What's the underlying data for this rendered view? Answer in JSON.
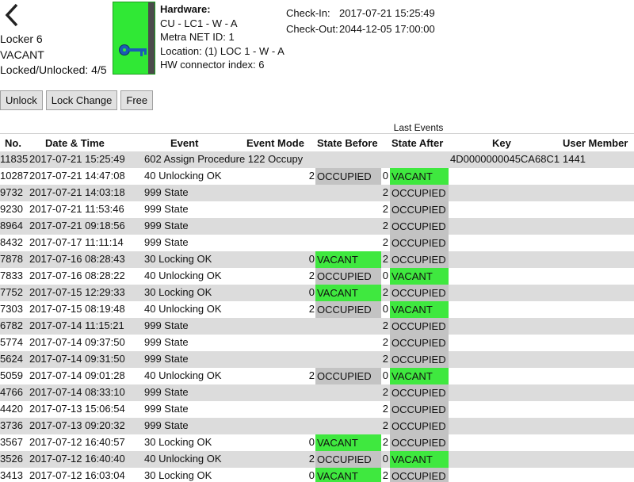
{
  "locker": {
    "name": "Locker 6",
    "status": "VACANT",
    "locked_unlocked": "Locked/Unlocked: 4/5",
    "tile_color": "#30e835",
    "icon": "key-icon"
  },
  "hardware": {
    "title": "Hardware:",
    "lines": [
      "CU - LC1 - W - A",
      "Metra NET ID: 1",
      "Location: (1) LOC 1 - W - A",
      "HW connector index: 6"
    ]
  },
  "checks": {
    "checkin_label": "Check-In:",
    "checkin_value": "2017-07-21 15:25:49",
    "checkout_label": "Check-Out:",
    "checkout_value": "2044-12-05 17:00:00"
  },
  "buttons": {
    "unlock": "Unlock",
    "lock_change": "Lock Change",
    "free": "Free"
  },
  "events": {
    "title": "Last Events",
    "headers": [
      "No.",
      "Date & Time",
      "Event",
      "Event Mode",
      "State Before",
      "State After",
      "Key",
      "User Member"
    ],
    "colors": {
      "occupied": "#c3c3c3",
      "vacant": "#3fe83f",
      "row_stripe": "#dcdcdc"
    },
    "rows": [
      {
        "no": "11835",
        "dt": "2017-07-21 15:25:49",
        "event": "602 Assign Procedure 122 Occupy",
        "sbn": "",
        "sb": "",
        "san": "",
        "sa": "",
        "key": "4D0000000045CA68C1",
        "um": "1441"
      },
      {
        "no": "10287",
        "dt": "2017-07-21 14:47:08",
        "event": "40 Unlocking OK",
        "sbn": "2",
        "sb": "OCCUPIED",
        "san": "0",
        "sa": "VACANT",
        "key": "",
        "um": ""
      },
      {
        "no": "9732",
        "dt": "2017-07-21 14:03:18",
        "event": "999 State",
        "sbn": "",
        "sb": "",
        "san": "2",
        "sa": "OCCUPIED",
        "key": "",
        "um": ""
      },
      {
        "no": "9230",
        "dt": "2017-07-21 11:53:46",
        "event": "999 State",
        "sbn": "",
        "sb": "",
        "san": "2",
        "sa": "OCCUPIED",
        "key": "",
        "um": ""
      },
      {
        "no": "8964",
        "dt": "2017-07-21 09:18:56",
        "event": "999 State",
        "sbn": "",
        "sb": "",
        "san": "2",
        "sa": "OCCUPIED",
        "key": "",
        "um": ""
      },
      {
        "no": "8432",
        "dt": "2017-07-17 11:11:14",
        "event": "999 State",
        "sbn": "",
        "sb": "",
        "san": "2",
        "sa": "OCCUPIED",
        "key": "",
        "um": ""
      },
      {
        "no": "7878",
        "dt": "2017-07-16 08:28:43",
        "event": "30 Locking OK",
        "sbn": "0",
        "sb": "VACANT",
        "san": "2",
        "sa": "OCCUPIED",
        "key": "",
        "um": ""
      },
      {
        "no": "7833",
        "dt": "2017-07-16 08:28:22",
        "event": "40 Unlocking OK",
        "sbn": "2",
        "sb": "OCCUPIED",
        "san": "0",
        "sa": "VACANT",
        "key": "",
        "um": ""
      },
      {
        "no": "7752",
        "dt": "2017-07-15 12:29:33",
        "event": "30 Locking OK",
        "sbn": "0",
        "sb": "VACANT",
        "san": "2",
        "sa": "OCCUPIED",
        "key": "",
        "um": ""
      },
      {
        "no": "7303",
        "dt": "2017-07-15 08:19:48",
        "event": "40 Unlocking OK",
        "sbn": "2",
        "sb": "OCCUPIED",
        "san": "0",
        "sa": "VACANT",
        "key": "",
        "um": ""
      },
      {
        "no": "6782",
        "dt": "2017-07-14 11:15:21",
        "event": "999 State",
        "sbn": "",
        "sb": "",
        "san": "2",
        "sa": "OCCUPIED",
        "key": "",
        "um": ""
      },
      {
        "no": "5774",
        "dt": "2017-07-14 09:37:50",
        "event": "999 State",
        "sbn": "",
        "sb": "",
        "san": "2",
        "sa": "OCCUPIED",
        "key": "",
        "um": ""
      },
      {
        "no": "5624",
        "dt": "2017-07-14 09:31:50",
        "event": "999 State",
        "sbn": "",
        "sb": "",
        "san": "2",
        "sa": "OCCUPIED",
        "key": "",
        "um": ""
      },
      {
        "no": "5059",
        "dt": "2017-07-14 09:01:28",
        "event": "40 Unlocking OK",
        "sbn": "2",
        "sb": "OCCUPIED",
        "san": "0",
        "sa": "VACANT",
        "key": "",
        "um": ""
      },
      {
        "no": "4766",
        "dt": "2017-07-14 08:33:10",
        "event": "999 State",
        "sbn": "",
        "sb": "",
        "san": "2",
        "sa": "OCCUPIED",
        "key": "",
        "um": ""
      },
      {
        "no": "4420",
        "dt": "2017-07-13 15:06:54",
        "event": "999 State",
        "sbn": "",
        "sb": "",
        "san": "2",
        "sa": "OCCUPIED",
        "key": "",
        "um": ""
      },
      {
        "no": "3736",
        "dt": "2017-07-13 09:20:32",
        "event": "999 State",
        "sbn": "",
        "sb": "",
        "san": "2",
        "sa": "OCCUPIED",
        "key": "",
        "um": ""
      },
      {
        "no": "3567",
        "dt": "2017-07-12 16:40:57",
        "event": "30 Locking OK",
        "sbn": "0",
        "sb": "VACANT",
        "san": "2",
        "sa": "OCCUPIED",
        "key": "",
        "um": ""
      },
      {
        "no": "3526",
        "dt": "2017-07-12 16:40:40",
        "event": "40 Unlocking OK",
        "sbn": "2",
        "sb": "OCCUPIED",
        "san": "0",
        "sa": "VACANT",
        "key": "",
        "um": ""
      },
      {
        "no": "3413",
        "dt": "2017-07-12 16:03:04",
        "event": "30 Locking OK",
        "sbn": "0",
        "sb": "VACANT",
        "san": "2",
        "sa": "OCCUPIED",
        "key": "",
        "um": ""
      }
    ]
  }
}
